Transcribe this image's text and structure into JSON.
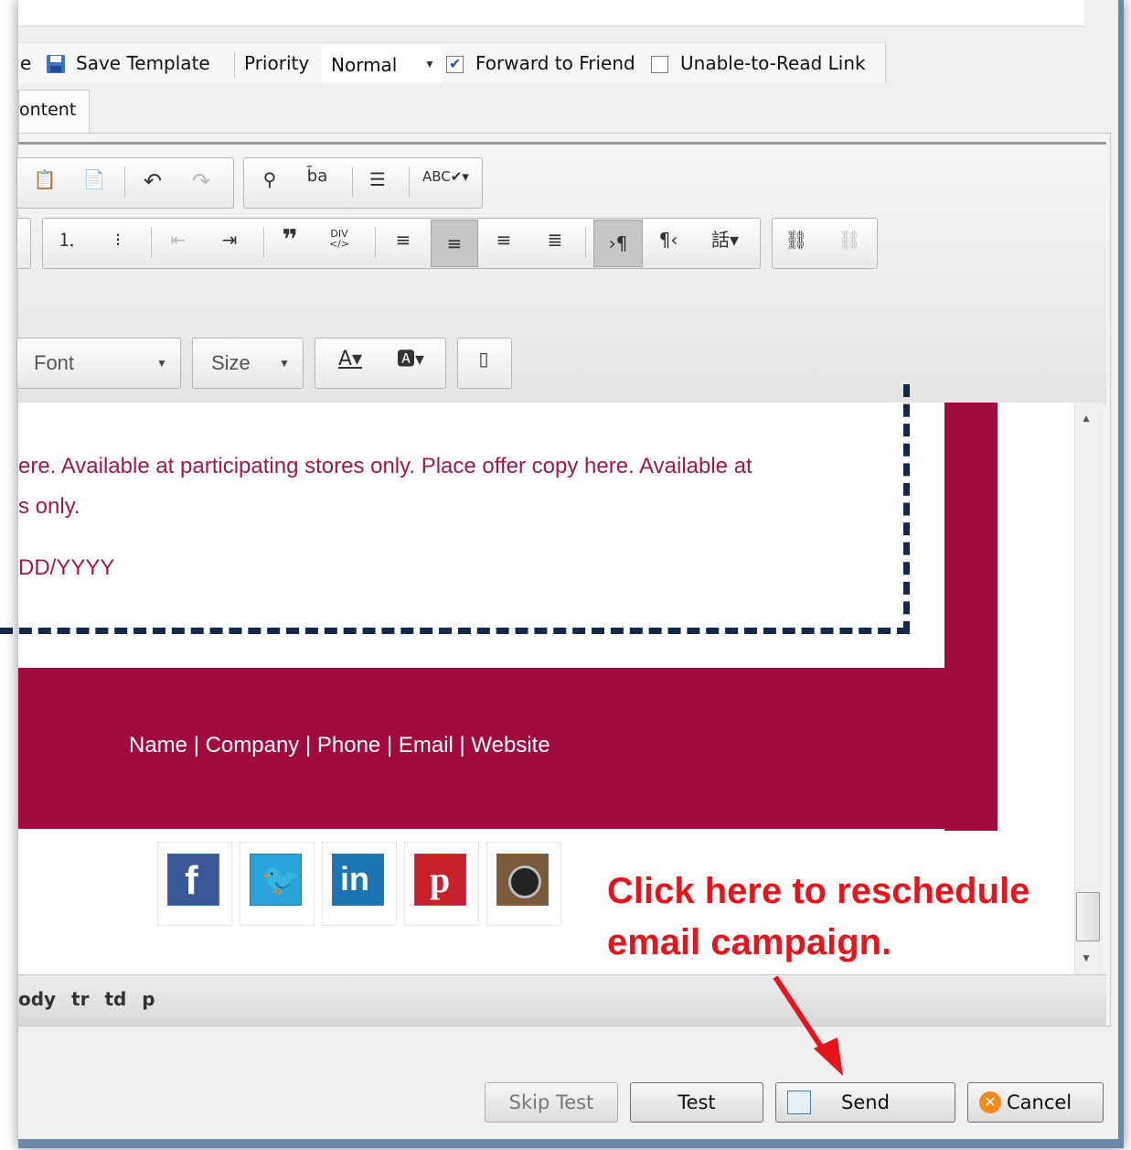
{
  "options_bar": {
    "partial_label": "e",
    "save_template_label": "Save Template",
    "priority_label": "Priority",
    "priority_value": "Normal",
    "forward_label": "Forward to Friend",
    "forward_checked": true,
    "unable_label": "Unable-to-Read Link",
    "unable_checked": false
  },
  "tabs": {
    "content_label": "ontent"
  },
  "toolbar": {
    "font_label": "Font",
    "size_label": "Size",
    "icons": [
      "paste-text-icon",
      "paste-word-icon",
      "undo-icon",
      "redo-icon",
      "find-icon",
      "replace-icon",
      "select-all-icon",
      "spellcheck-icon",
      "numbered-list-icon",
      "bulleted-list-icon",
      "outdent-icon",
      "indent-icon",
      "blockquote-icon",
      "create-div-icon",
      "align-left-icon",
      "align-center-icon",
      "align-right-icon",
      "justify-icon",
      "ltr-icon",
      "rtl-icon",
      "language-icon",
      "link-icon",
      "unlink-icon",
      "text-color-icon",
      "background-color-icon",
      "maximize-icon"
    ]
  },
  "content": {
    "offer_line1": "ere. Available at participating stores only. Place offer copy here. Available at",
    "offer_line2": "s only.",
    "expiry_text": "DD/YYYY",
    "footer_text": "Name | Company | Phone | Email | Website",
    "social": [
      "facebook-icon",
      "twitter-icon",
      "linkedin-icon",
      "pinterest-icon",
      "instagram-icon"
    ],
    "brand_color": "#a30a3c"
  },
  "status_bar": {
    "breadcrumb": "ody  tr  td  p"
  },
  "buttons": {
    "skip_test": "Skip Test",
    "test": "Test",
    "send": "Send",
    "cancel": "Cancel"
  },
  "annotation": {
    "line1": "Click here to reschedule",
    "line2": "email campaign.",
    "color": "#e8141b"
  }
}
